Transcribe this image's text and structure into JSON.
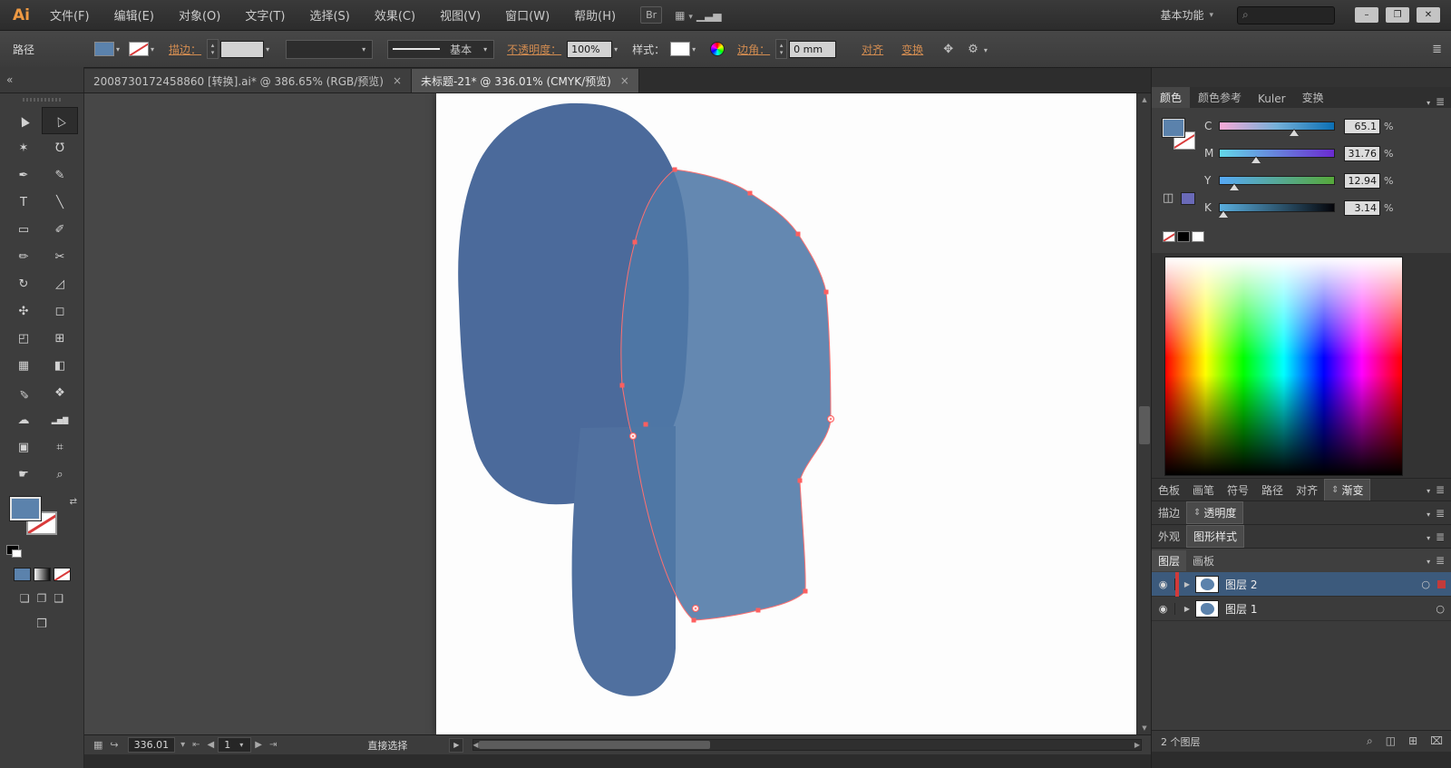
{
  "colors": {
    "fill_blue": "#5b82ac",
    "dark_blob": "#4b6a9b",
    "mid_blob": "#50709f",
    "light_shape": "#4f78a6",
    "selection_red": "#ff6a6a"
  },
  "menubar": {
    "logo": "Ai",
    "items": [
      "文件(F)",
      "编辑(E)",
      "对象(O)",
      "文字(T)",
      "选择(S)",
      "效果(C)",
      "视图(V)",
      "窗口(W)",
      "帮助(H)"
    ],
    "bridge": "Br",
    "workspace": "基本功能"
  },
  "window": {
    "minimize": "–",
    "restore": "❐",
    "close": "✕"
  },
  "controlbar": {
    "selection_type": "路径",
    "stroke_link": "描边：",
    "stroke_style": "基本",
    "opacity_link": "不透明度：",
    "opacity_value": "100%",
    "style_label": "样式：",
    "corner_link": "边角：",
    "corner_value": "0 mm",
    "align_link": "对齐",
    "transform_link": "变换"
  },
  "doc_tabs": {
    "tab1": "2008730172458860 [转换].ai* @ 386.65% (RGB/预览)",
    "tab2": "未标题-21* @ 336.01% (CMYK/预览)",
    "close": "×"
  },
  "toolbar": {
    "collapse": "«",
    "tools": [
      {
        "name": "selection",
        "glyph": "▲"
      },
      {
        "name": "direct-selection",
        "glyph": "△"
      },
      {
        "name": "magic-wand",
        "glyph": "✶"
      },
      {
        "name": "lasso",
        "glyph": "℧"
      },
      {
        "name": "pen",
        "glyph": "✒"
      },
      {
        "name": "add-anchor-point",
        "glyph": "✎"
      },
      {
        "name": "type",
        "glyph": "T"
      },
      {
        "name": "line-segment",
        "glyph": "╲"
      },
      {
        "name": "rectangle",
        "glyph": "▭"
      },
      {
        "name": "paintbrush",
        "glyph": "✐"
      },
      {
        "name": "pencil",
        "glyph": "✏"
      },
      {
        "name": "scissors",
        "glyph": "✂"
      },
      {
        "name": "rotate",
        "glyph": "↻"
      },
      {
        "name": "scale",
        "glyph": "◿"
      },
      {
        "name": "width",
        "glyph": "✣"
      },
      {
        "name": "free-transform",
        "glyph": "◻"
      },
      {
        "name": "shape-builder",
        "glyph": "◰"
      },
      {
        "name": "perspective-grid",
        "glyph": "⊞"
      },
      {
        "name": "mesh",
        "glyph": "▦"
      },
      {
        "name": "gradient",
        "glyph": "◧"
      },
      {
        "name": "eyedropper",
        "glyph": "✎"
      },
      {
        "name": "blend",
        "glyph": "❖"
      },
      {
        "name": "symbol-sprayer",
        "glyph": "☁"
      },
      {
        "name": "column-graph",
        "glyph": "▂▅▇"
      },
      {
        "name": "artboard",
        "glyph": "▣"
      },
      {
        "name": "slice",
        "glyph": "⌗"
      },
      {
        "name": "hand",
        "glyph": "☛"
      },
      {
        "name": "zoom",
        "glyph": "⌕"
      }
    ]
  },
  "color_panel": {
    "tabs": [
      "颜色",
      "颜色参考",
      "Kuler",
      "变换"
    ],
    "unit": "%",
    "channels": [
      {
        "label": "C",
        "value": "65.1",
        "pct": 65
      },
      {
        "label": "M",
        "value": "31.76",
        "pct": 32
      },
      {
        "label": "Y",
        "value": "12.94",
        "pct": 13
      },
      {
        "label": "K",
        "value": "3.14",
        "pct": 3
      }
    ]
  },
  "panel_strips": {
    "swatch_tabs": [
      "色板",
      "画笔",
      "符号",
      "路径",
      "对齐",
      "渐变"
    ],
    "stroke_tab": "描边",
    "transparency_tab": "透明度",
    "appearance_tab": "外观",
    "graphic_styles_tab": "图形样式",
    "layers_tab": "图层",
    "artboards_tab": "画板"
  },
  "layers": {
    "rows": [
      {
        "name": "图层 2"
      },
      {
        "name": "图层 1"
      }
    ],
    "count": "2 个图层"
  },
  "statusbar": {
    "zoom": "336.01",
    "artboard_number": "1",
    "tool": "直接选择"
  },
  "icons": {
    "caret": "▾",
    "up": "▴",
    "down": "▾",
    "arrange": "▦",
    "signal": "▁▃▅",
    "search": "⌕",
    "fourway": "✥",
    "gear": "⚙",
    "panel_menu": "≣",
    "updown": "⇕",
    "expand": "▶",
    "eye": "◉",
    "target": "○",
    "swap": "⇄",
    "first": "⇤",
    "prev": "◀",
    "next": "▶",
    "last": "⇥",
    "left": "◀",
    "right": "▶",
    "scroll_up": "▲",
    "scroll_down": "▼",
    "status_a": "▦",
    "status_b": "↪",
    "cube": "◫",
    "locate": "⌕",
    "mask": "◫",
    "new_layer": "⊞",
    "delete_layer": "⌧",
    "draw_normal": "❏",
    "draw_behind": "❐",
    "draw_inside": "❑",
    "screen_mode": "❒"
  }
}
